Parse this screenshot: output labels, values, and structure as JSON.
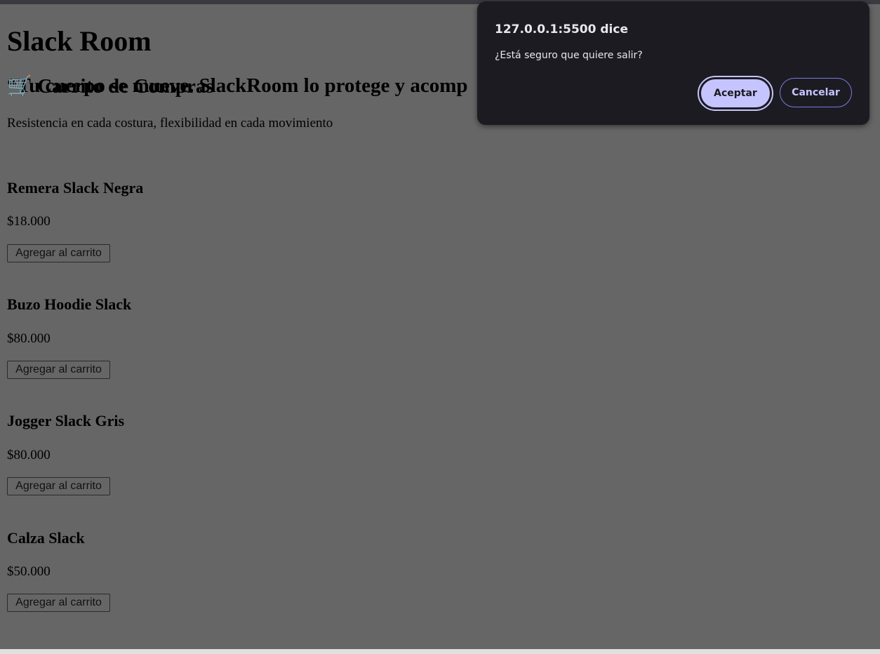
{
  "page": {
    "title": "Slack Room",
    "tagline": "“Tu cuerpo se mueve. SlackRoom lo protege y acomp",
    "lead": "Resistencia en cada costura, flexibilidad en cada movimiento",
    "products": [
      {
        "name": "Remera Slack Negra",
        "price": "$18.000",
        "button": "Agregar al carrito"
      },
      {
        "name": "Buzo Hoodie Slack",
        "price": "$80.000",
        "button": "Agregar al carrito"
      },
      {
        "name": "Jogger Slack Gris",
        "price": "$80.000",
        "button": "Agregar al carrito"
      },
      {
        "name": "Calza Slack",
        "price": "$50.000",
        "button": "Agregar al carrito"
      }
    ],
    "cart_icon": "shopping-cart-icon",
    "cart_title": "Carrito de Compras"
  },
  "dialog": {
    "title": "127.0.0.1:5500 dice",
    "message": "¿Está seguro que quiere salir?",
    "accept": "Aceptar",
    "cancel": "Cancelar",
    "accent": "#c6c4ff"
  }
}
